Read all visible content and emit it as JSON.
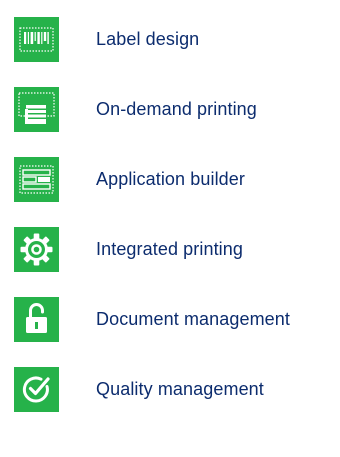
{
  "features": [
    {
      "label": "Label design",
      "icon": "barcode-label-icon"
    },
    {
      "label": "On-demand printing",
      "icon": "printer-icon"
    },
    {
      "label": "Application builder",
      "icon": "layout-grid-icon"
    },
    {
      "label": "Integrated printing",
      "icon": "gear-icon"
    },
    {
      "label": "Document management",
      "icon": "unlocked-padlock-icon"
    },
    {
      "label": "Quality management",
      "icon": "checkmark-circle-icon"
    }
  ],
  "colors": {
    "accent": "#26b24a",
    "text": "#0c2c6e"
  }
}
